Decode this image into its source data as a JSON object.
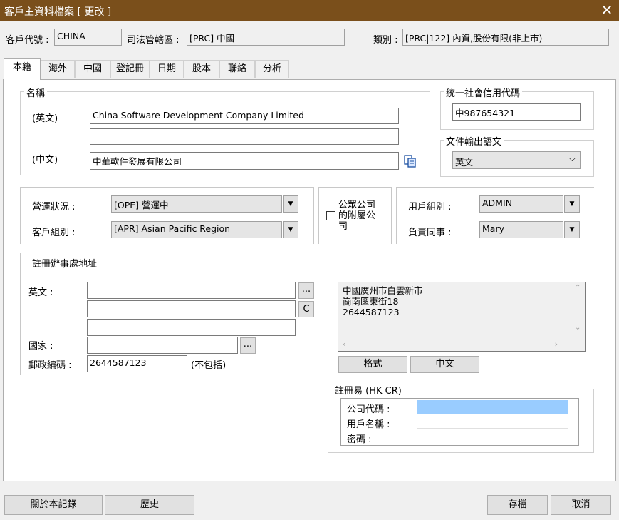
{
  "window": {
    "title": "客戶主資料檔案 [ 更改 ]"
  },
  "header": {
    "client_code_label": "客戶代號 :",
    "client_code": "CHINA",
    "jurisdiction_label": "司法管轄區 :",
    "jurisdiction": "[PRC] 中國",
    "category_label": "類別 :",
    "category": "[PRC|122] 內資,股份有限(非上市)"
  },
  "tabs": [
    {
      "label": "本籍"
    },
    {
      "label": "海外"
    },
    {
      "label": "中國"
    },
    {
      "label": "登記冊"
    },
    {
      "label": "日期"
    },
    {
      "label": "股本"
    },
    {
      "label": "聯絡"
    },
    {
      "label": "分析"
    }
  ],
  "name_group": {
    "title": "名稱",
    "english_label": "(英文)",
    "english_line1": "China Software Development Company Limited",
    "english_line2": "",
    "chinese_label": "(中文)",
    "chinese": "中華軟件發展有限公司"
  },
  "uscc": {
    "title": "統一社會信用代碼",
    "value": "中987654321"
  },
  "output_language": {
    "title": "文件輸出語文",
    "value": "英文"
  },
  "status": {
    "operation_label": "營運狀況 :",
    "operation": "[OPE] 營運中",
    "client_group_label": "客戶組別 :",
    "client_group": "[APR] Asian Pacific Region"
  },
  "public_subsidiary": {
    "label_line1": "公眾公司",
    "label_line2": "的附屬公",
    "label_line3": "司"
  },
  "users": {
    "user_group_label": "用戶組別 :",
    "user_group": "ADMIN",
    "in_charge_label": "負責同事 :",
    "in_charge": "Mary"
  },
  "address": {
    "title": "註冊辦事處地址",
    "english_label": "英文 :",
    "line1": "",
    "line2": "",
    "line3": "",
    "ellipsis_btn": "...",
    "c_btn": "C",
    "country_label": "國家 :",
    "country": "",
    "country_btn": "...",
    "postal_label": "郵政編碼 :",
    "postal": "2644587123",
    "postal_note": "(不包括)",
    "chinese_text_line1": "中國廣州市白雲新市",
    "chinese_text_line2": "崗南區東街18",
    "chinese_text_line3": "2644587123",
    "format_btn": "格式",
    "chinese_btn": "中文"
  },
  "hkcr": {
    "title": "註冊易 (HK CR)",
    "company_code_label": "公司代碼 :",
    "company_code": "",
    "username_label": "用戶名稱 :",
    "username": "",
    "password_label": "密碼 :",
    "password": ""
  },
  "footer": {
    "about_btn": "關於本記錄",
    "history_btn": "歷史",
    "save_btn": "存檔",
    "cancel_btn": "取消"
  },
  "colors": {
    "titlebar": "#7a4f1b",
    "highlight": "#99ccff"
  }
}
